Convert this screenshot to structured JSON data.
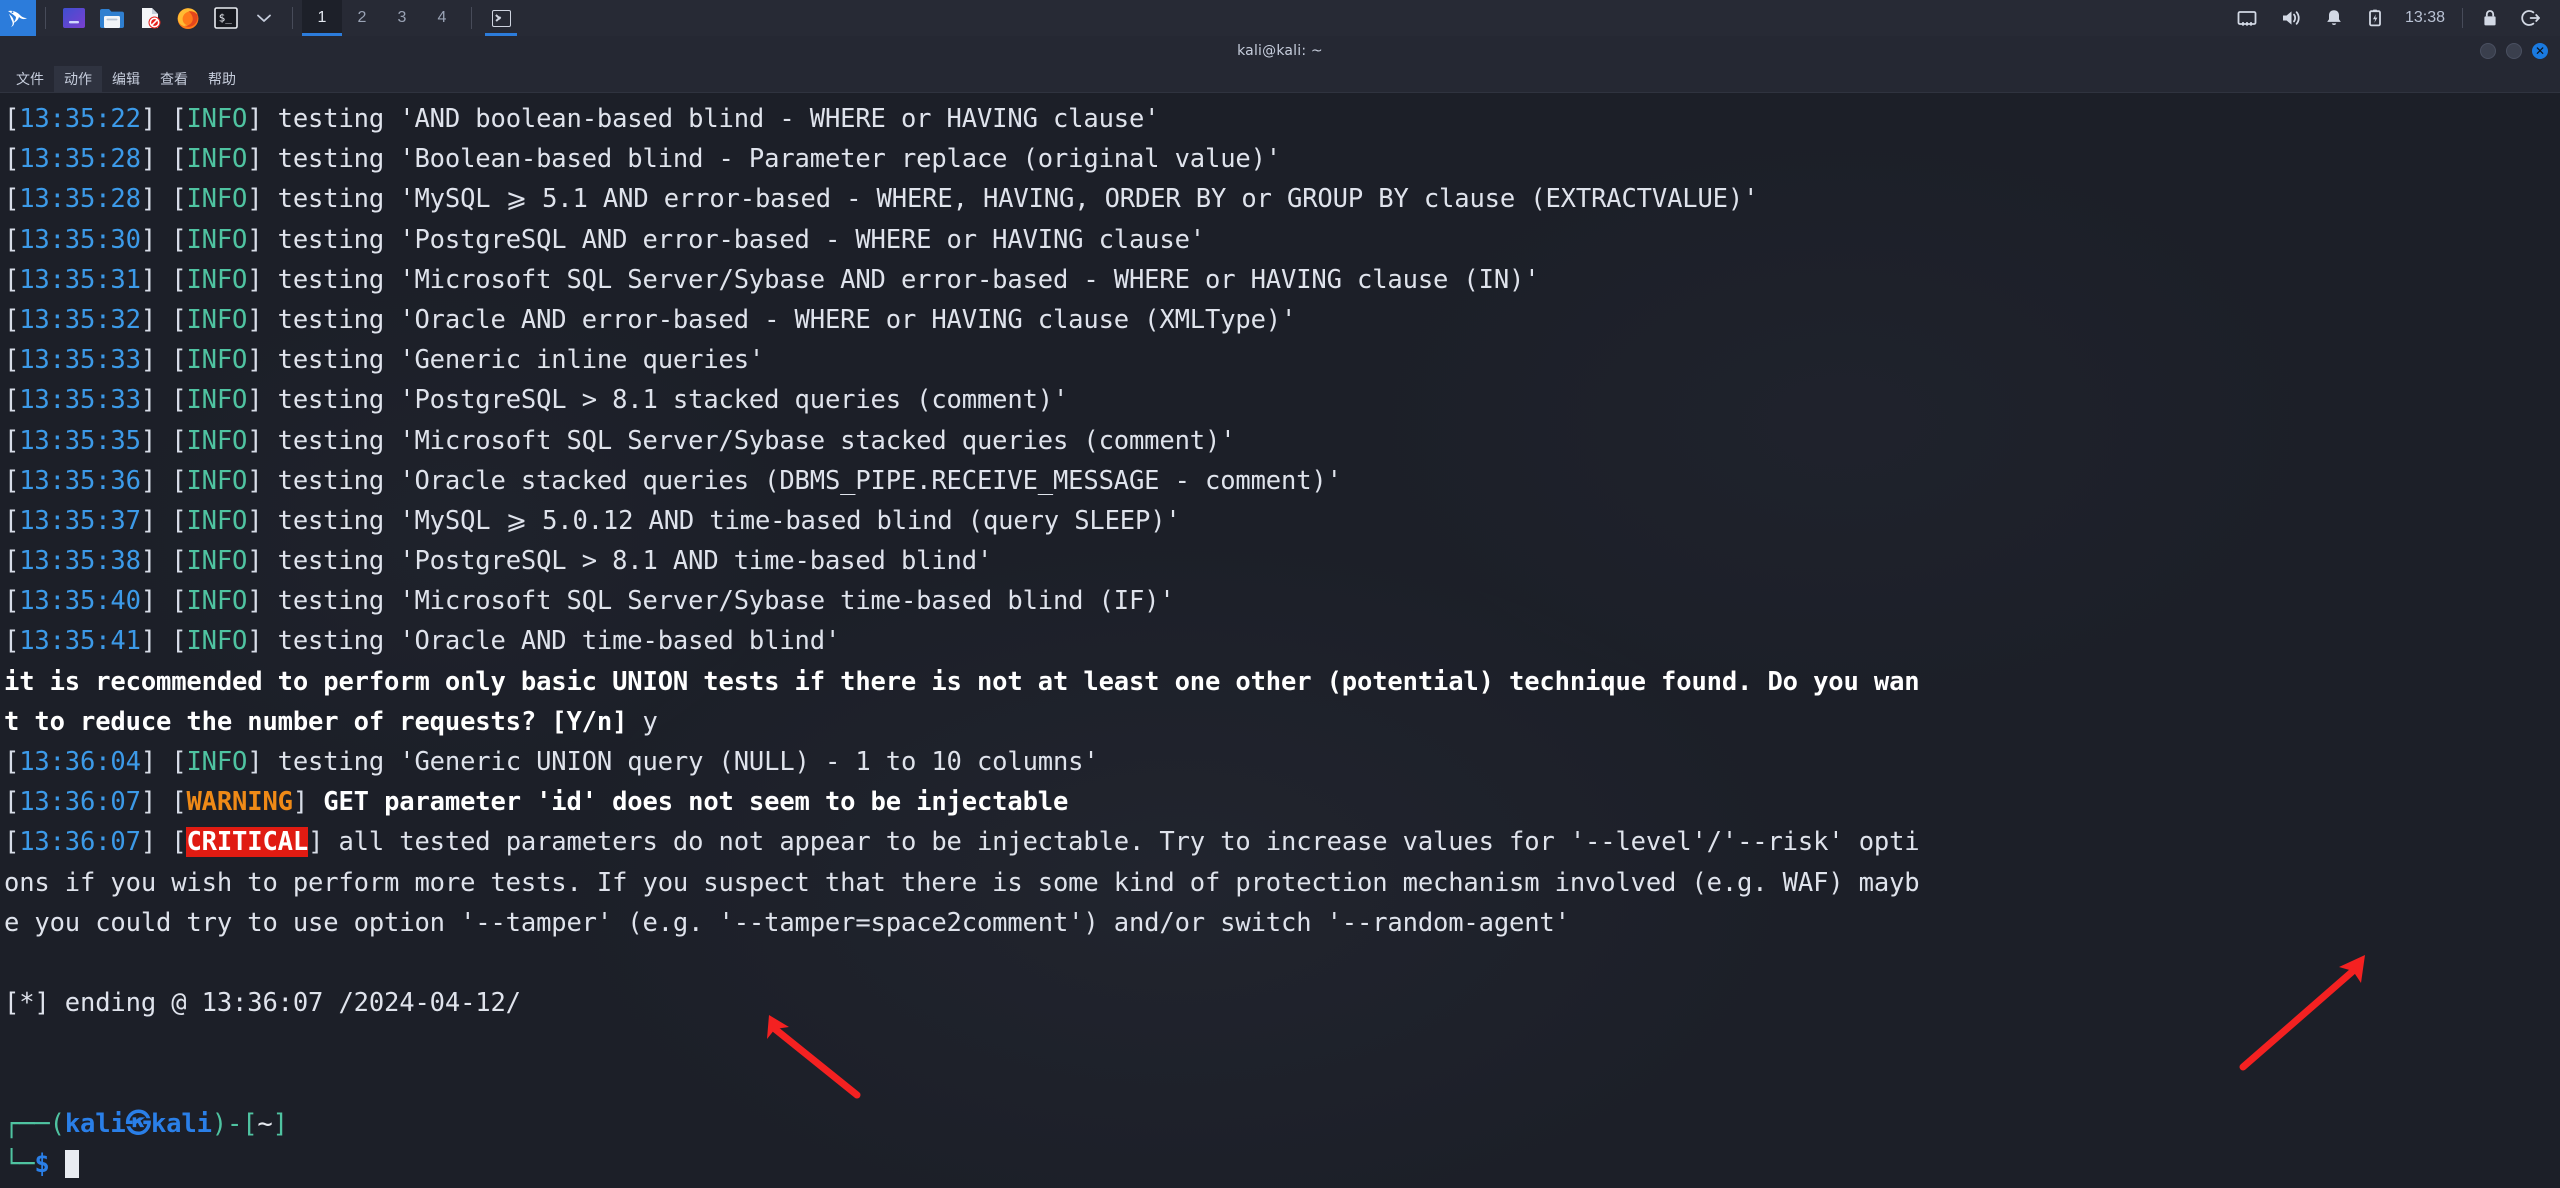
{
  "taskbar": {
    "logo": "kali-dragon-logo",
    "launchers": [
      {
        "name": "app-menu-icon",
        "label": ""
      },
      {
        "name": "files-icon",
        "label": ""
      },
      {
        "name": "text-editor-icon",
        "label": ""
      },
      {
        "name": "firefox-icon",
        "label": ""
      },
      {
        "name": "terminal-icon",
        "label": "$_"
      },
      {
        "name": "chevron-down-icon",
        "label": ""
      }
    ],
    "workspaces": [
      "1",
      "2",
      "3",
      "4"
    ],
    "active_workspace": "1",
    "window_buttons": [
      {
        "name": "taskbar-window-terminal",
        "label": ""
      }
    ],
    "tray": {
      "network_icon": "network-icon",
      "volume_icon": "volume-icon",
      "notification_icon": "bell-icon",
      "battery_icon": "battery-icon",
      "clock": "13:38",
      "lock_icon": "lock-icon",
      "logout_icon": "logout-icon"
    }
  },
  "window": {
    "title": "kali@kali: ~",
    "buttons": {
      "minimize": "",
      "maximize": "",
      "close": "✕"
    }
  },
  "menubar": {
    "items": [
      {
        "label": "文件",
        "name": "menu-file"
      },
      {
        "label": "动作",
        "name": "menu-actions"
      },
      {
        "label": "编辑",
        "name": "menu-edit"
      },
      {
        "label": "查看",
        "name": "menu-view"
      },
      {
        "label": "帮助",
        "name": "menu-help"
      }
    ]
  },
  "terminal": {
    "log_lines": [
      {
        "time": "13:35:22",
        "level": "INFO",
        "msg": "testing 'AND boolean-based blind - WHERE or HAVING clause'"
      },
      {
        "time": "13:35:28",
        "level": "INFO",
        "msg": "testing 'Boolean-based blind - Parameter replace (original value)'"
      },
      {
        "time": "13:35:28",
        "level": "INFO",
        "msg": "testing 'MySQL ⩾ 5.1 AND error-based - WHERE, HAVING, ORDER BY or GROUP BY clause (EXTRACTVALUE)'"
      },
      {
        "time": "13:35:30",
        "level": "INFO",
        "msg": "testing 'PostgreSQL AND error-based - WHERE or HAVING clause'"
      },
      {
        "time": "13:35:31",
        "level": "INFO",
        "msg": "testing 'Microsoft SQL Server/Sybase AND error-based - WHERE or HAVING clause (IN)'"
      },
      {
        "time": "13:35:32",
        "level": "INFO",
        "msg": "testing 'Oracle AND error-based - WHERE or HAVING clause (XMLType)'"
      },
      {
        "time": "13:35:33",
        "level": "INFO",
        "msg": "testing 'Generic inline queries'"
      },
      {
        "time": "13:35:33",
        "level": "INFO",
        "msg": "testing 'PostgreSQL > 8.1 stacked queries (comment)'"
      },
      {
        "time": "13:35:35",
        "level": "INFO",
        "msg": "testing 'Microsoft SQL Server/Sybase stacked queries (comment)'"
      },
      {
        "time": "13:35:36",
        "level": "INFO",
        "msg": "testing 'Oracle stacked queries (DBMS_PIPE.RECEIVE_MESSAGE - comment)'"
      },
      {
        "time": "13:35:37",
        "level": "INFO",
        "msg": "testing 'MySQL ⩾ 5.0.12 AND time-based blind (query SLEEP)'"
      },
      {
        "time": "13:35:38",
        "level": "INFO",
        "msg": "testing 'PostgreSQL > 8.1 AND time-based blind'"
      },
      {
        "time": "13:35:40",
        "level": "INFO",
        "msg": "testing 'Microsoft SQL Server/Sybase time-based blind (IF)'"
      },
      {
        "time": "13:35:41",
        "level": "INFO",
        "msg": "testing 'Oracle AND time-based blind'"
      }
    ],
    "prompt_question_line1": "it is recommended to perform only basic UNION tests if there is not at least one other (potential) technique found. Do you wan",
    "prompt_question_line2": "t to reduce the number of requests? [Y/n] ",
    "prompt_answer": "y",
    "union_line": {
      "time": "13:36:04",
      "level": "INFO",
      "msg": "testing 'Generic UNION query (NULL) - 1 to 10 columns'"
    },
    "warning_line": {
      "time": "13:36:07",
      "level": "WARNING",
      "msg": "GET parameter 'id' does not seem to be injectable"
    },
    "critical_line": {
      "time": "13:36:07",
      "level": "CRITICAL",
      "msg_part1": "all tested parameters do not appear to be injectable. Try to increase values for '--level'/'--risk' opti",
      "msg_part2": "ons if you wish to perform more tests. If you suspect that there is some kind of protection mechanism involved (e.g. WAF) mayb",
      "msg_part3": "e you could try to use option '--tamper' (e.g. '--tamper=space2comment') and/or switch '--random-agent'"
    },
    "ending_line": "[*] ending @ 13:36:07 /2024-04-12/",
    "shell_prompt": {
      "user": "kali",
      "separator_icon": "kali-at-icon",
      "host": "kali",
      "path": "~",
      "dollar": "$",
      "cursor": ""
    }
  },
  "annotations": {
    "arrows": [
      {
        "name": "annotation-arrow-tamper",
        "color": "#f42121"
      },
      {
        "name": "annotation-arrow-waf",
        "color": "#f42121"
      }
    ]
  },
  "colors": {
    "accent": "#2c7cdb",
    "info": "#4fc3a1",
    "time": "#3c9ae8",
    "warning": "#ef8a17",
    "critical_bg": "#e01b12",
    "terminal_bg": "#1c1f28",
    "taskbar_bg": "#272a35"
  }
}
